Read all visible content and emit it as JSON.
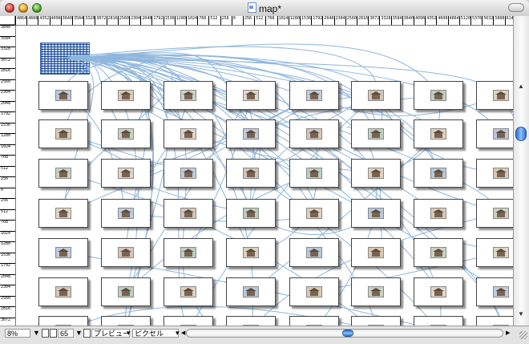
{
  "window": {
    "title": "map*"
  },
  "ruler_top": [
    "4864",
    "4608",
    "4352",
    "4096",
    "3840",
    "3584",
    "3328",
    "3072",
    "2816",
    "2560",
    "2304",
    "2048",
    "1792",
    "1536",
    "1280",
    "1024",
    "768",
    "512",
    "256",
    "0",
    "256",
    "512",
    "768",
    "1024",
    "1280",
    "1536",
    "1792",
    "2048",
    "2304",
    "2560",
    "2816",
    "3072",
    "3328",
    "3584",
    "3840",
    "4096",
    "4352",
    "4608",
    "4864",
    "5120",
    "5376",
    "5632",
    "5888",
    "6144",
    "6400"
  ],
  "ruler_left": [
    "3840",
    "3584",
    "3328",
    "3072",
    "2816",
    "2560",
    "2304",
    "2048",
    "1792",
    "1536",
    "1280",
    "1024",
    "768",
    "512",
    "256",
    "0",
    "256",
    "512",
    "768",
    "1024",
    "1280",
    "1536",
    "1792",
    "2048",
    "2304",
    "2560",
    "2816",
    "3072",
    "3328"
  ],
  "statusbar": {
    "zoom": "8%",
    "page": "65",
    "mode": "プレビュー",
    "unit": "ピクセル"
  },
  "colors": {
    "link": "#8fb6dd",
    "accent": "#2f6fd1"
  },
  "icons": {
    "close": "close-button",
    "minimize": "minimize-button",
    "zoom": "zoom-button",
    "document": "document-icon"
  }
}
